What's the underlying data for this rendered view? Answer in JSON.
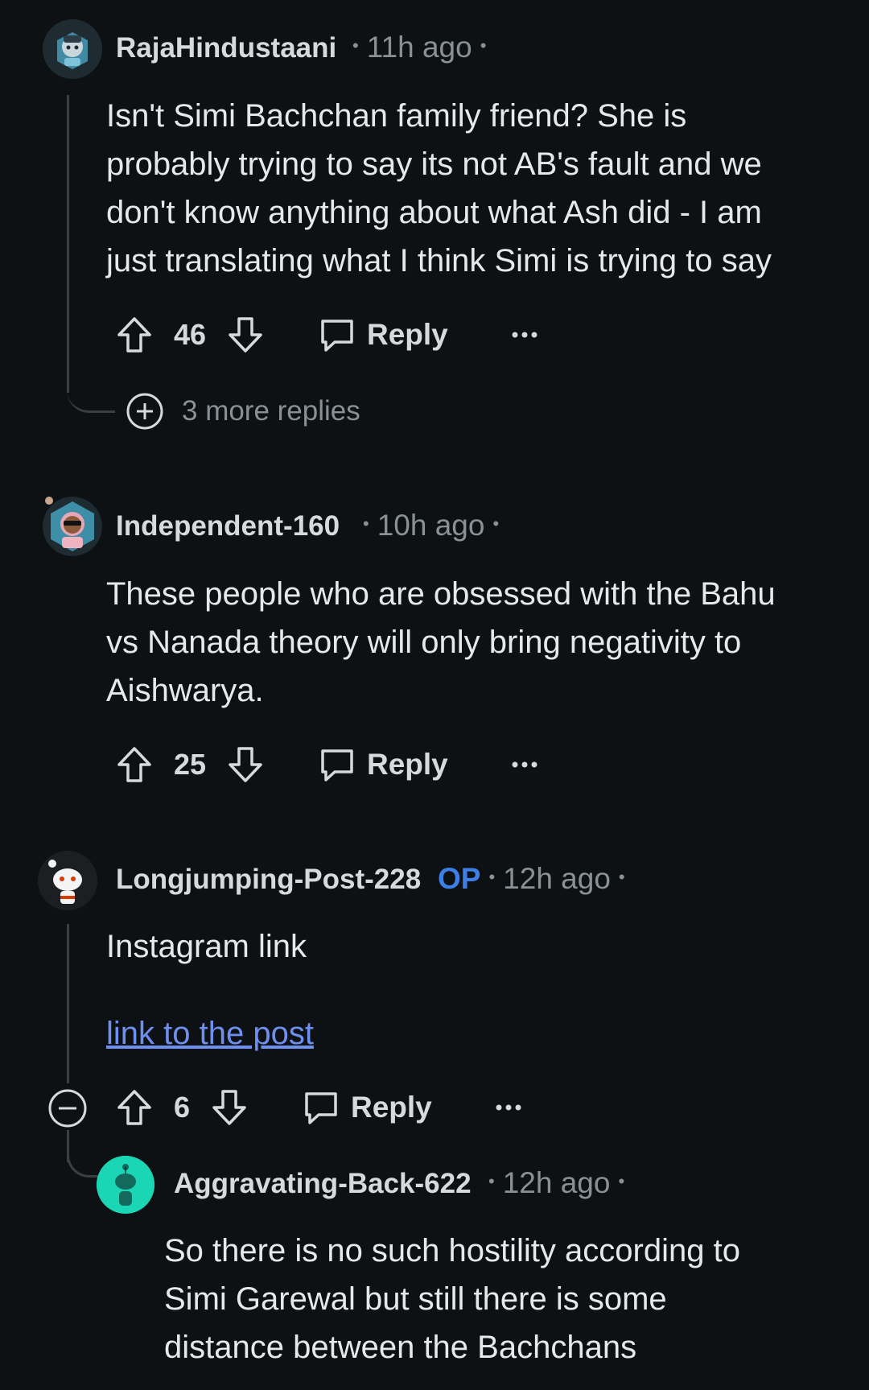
{
  "comments": [
    {
      "username": "RajaHindustaani",
      "time": "11h ago",
      "lines": [
        "Isn't Simi Bachchan family friend? She is",
        "probably trying to say its not AB's fault and we",
        "don't know anything about what Ash did - I am",
        "just translating what I think Simi is trying to say"
      ],
      "votes": "46",
      "reply_label": "Reply",
      "more_replies": "3 more replies"
    },
    {
      "username": "Independent-160",
      "time": "10h ago",
      "lines": [
        "These people who are obsessed with the Bahu",
        "vs Nanada theory will only bring negativity to",
        "Aishwarya."
      ],
      "votes": "25",
      "reply_label": "Reply"
    },
    {
      "username": "Longjumping-Post-228",
      "badge": "OP",
      "time": "12h ago",
      "text": "Instagram link",
      "link_text": "link to the post",
      "votes": "6",
      "reply_label": "Reply"
    },
    {
      "username": "Aggravating-Back-622",
      "time": "12h ago",
      "lines": [
        "So there is no such hostility according to",
        "Simi Garewal but still there is some",
        "distance between the Bachchans"
      ]
    }
  ],
  "icons": {
    "upvote": "arrow-up-outline",
    "downvote": "arrow-down-outline",
    "reply": "speech-bubble-outline",
    "more": "ellipsis",
    "expand": "plus-circle",
    "collapse": "minus-circle"
  },
  "colors": {
    "background": "#0e1113",
    "op_badge": "#3d7fe6",
    "link": "#6f8ff0",
    "snoo_avatar": "#1ad6b5"
  }
}
